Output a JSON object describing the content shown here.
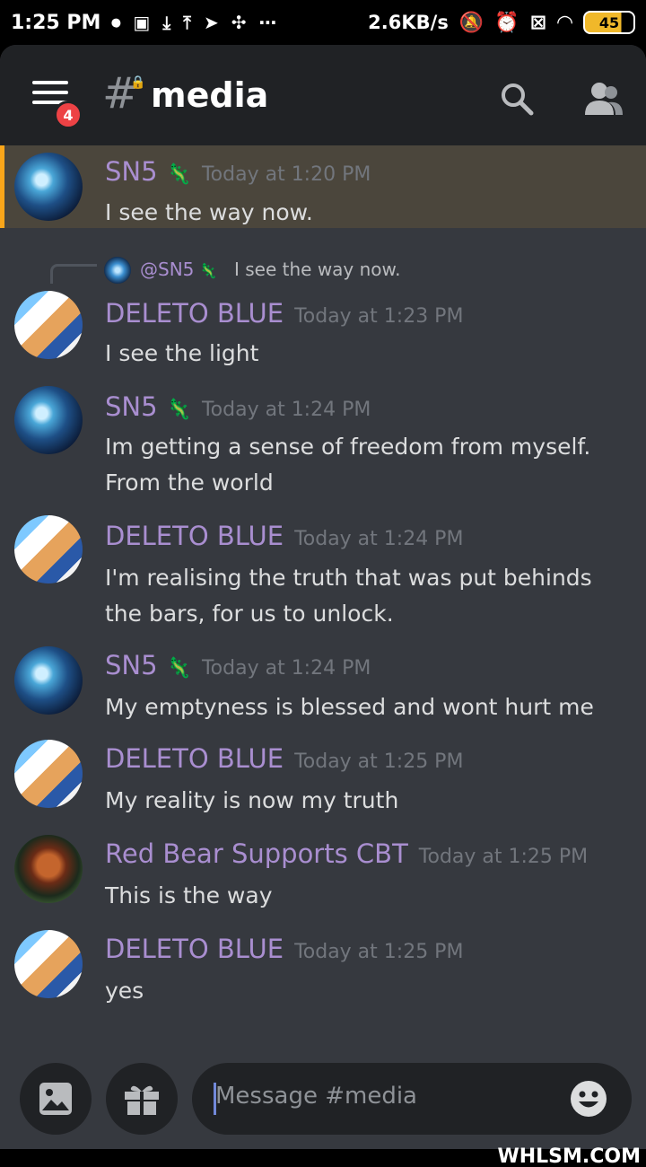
{
  "status_bar": {
    "time": "1:25 PM",
    "net_speed": "2.6KB/s",
    "battery": "45"
  },
  "header": {
    "channel_name": "media",
    "menu_badge": "4",
    "icons": [
      "menu-icon",
      "hash-lock-icon",
      "search-icon",
      "members-icon"
    ]
  },
  "reply": {
    "name": "@SN5",
    "text": "I see the way now."
  },
  "messages": [
    {
      "author": "SN5",
      "timestamp": "Today at 1:20 PM",
      "text": "I see the way now."
    },
    {
      "author": "DELETO BLUE",
      "timestamp": "Today at 1:23 PM",
      "text": "I see the light"
    },
    {
      "author": "SN5",
      "timestamp": "Today at 1:24 PM",
      "text": "Im getting a sense of freedom from myself. From the world"
    },
    {
      "author": "DELETO BLUE",
      "timestamp": "Today at 1:24 PM",
      "text": "I'm realising the truth that was put behinds the bars, for us to unlock."
    },
    {
      "author": "SN5",
      "timestamp": "Today at 1:24 PM",
      "text": "My emptyness is blessed and wont hurt me"
    },
    {
      "author": "DELETO BLUE",
      "timestamp": "Today at 1:25 PM",
      "text": "My reality is now my truth"
    },
    {
      "author": "Red Bear Supports CBT",
      "timestamp": "Today at 1:25 PM",
      "text": "This is the way"
    },
    {
      "author": "DELETO BLUE",
      "timestamp": "Today at 1:25 PM",
      "text": "yes"
    }
  ],
  "input": {
    "placeholder": "Message #media"
  },
  "colors": {
    "background": "#36393f",
    "header": "#202225",
    "username": "#a98ed0",
    "highlight": "#4b463c",
    "highlight_bar": "#faa61a",
    "badge": "#ed4245"
  },
  "watermark": "WHLSM.COM"
}
